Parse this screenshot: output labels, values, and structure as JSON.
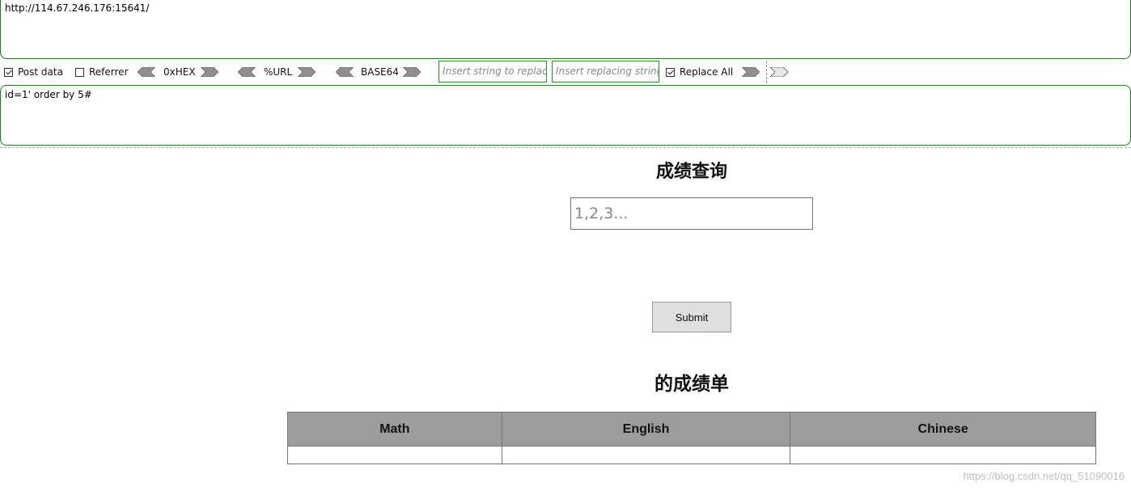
{
  "hackbar": {
    "url": "http://114.67.246.176:15641/",
    "post_data": "id=1' order by 5#",
    "post_checkbox_label": "Post data",
    "post_checked": true,
    "referrer_label": "Referrer",
    "referrer_checked": false,
    "hex_label": "0xHEX",
    "url_label": "%URL",
    "base64_label": "BASE64",
    "replace_placeholder": "Insert string to replace",
    "replacing_placeholder": "Insert replacing string",
    "replace_all_label": "Replace All",
    "replace_all_checked": true
  },
  "page": {
    "title": "成绩查询",
    "input_placeholder": "1,2,3...",
    "submit_label": "Submit",
    "report_title": "的成绩单",
    "table_headers": [
      "Math",
      "English",
      "Chinese"
    ]
  },
  "watermark": "https://blog.csdn.net/qq_51090016",
  "colors": {
    "hackbar_border": "#1a7f1a",
    "table_header_bg": "#9d9d9d"
  }
}
